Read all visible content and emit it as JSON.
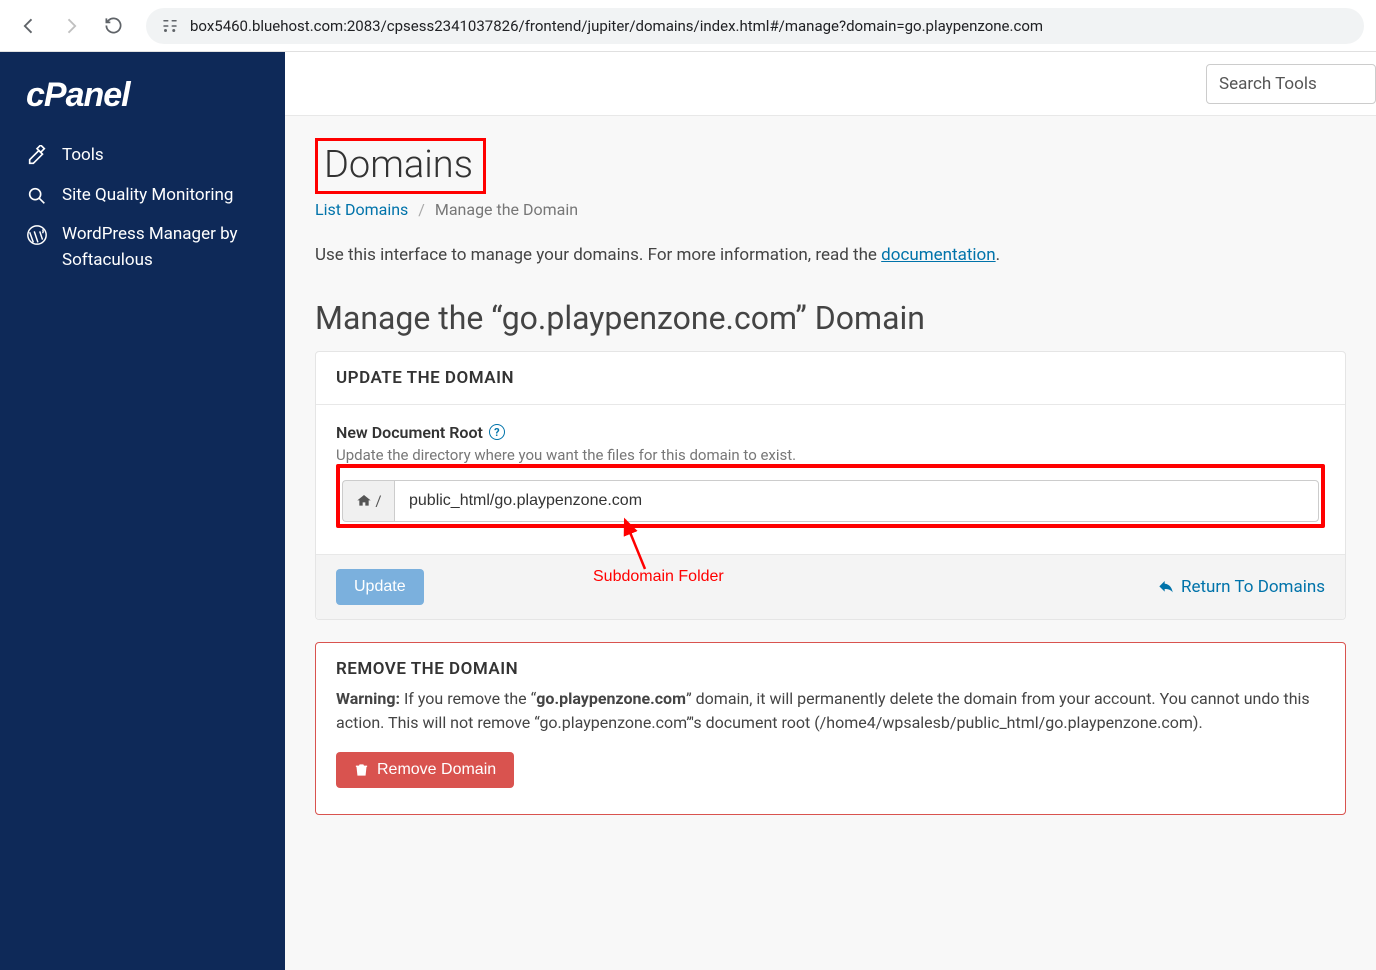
{
  "browser": {
    "url": "box5460.bluehost.com:2083/cpsess2341037826/frontend/jupiter/domains/index.html#/manage?domain=go.playpenzone.com"
  },
  "logo": {
    "text": "cPanel"
  },
  "sidebar": {
    "items": [
      {
        "label": "Tools",
        "icon": "tools-icon"
      },
      {
        "label": "Site Quality Monitoring",
        "icon": "magnify-icon"
      },
      {
        "label": "WordPress Manager by Softaculous",
        "icon": "wordpress-icon"
      }
    ]
  },
  "topbar": {
    "search_placeholder": "Search Tools"
  },
  "page": {
    "title": "Domains",
    "breadcrumb": {
      "link": "List Domains",
      "current": "Manage the Domain"
    },
    "intro_prefix": "Use this interface to manage your domains. For more information, read the ",
    "intro_link": "documentation",
    "intro_suffix": ".",
    "section_title": "Manage the “go.playpenzone.com” Domain"
  },
  "update_panel": {
    "header": "UPDATE THE DOMAIN",
    "field_label": "New Document Root",
    "field_help": "Update the directory where you want the files for this domain to exist.",
    "addon_suffix": "/",
    "value": "public_html/go.playpenzone.com",
    "update_btn": "Update",
    "return_link": "Return To Domains"
  },
  "remove_panel": {
    "header": "REMOVE THE DOMAIN",
    "warning_label": "Warning:",
    "warning_pre": " If you remove the “",
    "domain_bold": "go.playpenzone.com",
    "warning_post": "” domain, it will permanently delete the domain from your account. You cannot undo this action. This will not remove “go.playpenzone.com”'s document root (/home4/wpsalesb/public_html/go.playpenzone.com).",
    "remove_btn": "Remove Domain"
  },
  "annotation": {
    "label": "Subdomain Folder"
  }
}
